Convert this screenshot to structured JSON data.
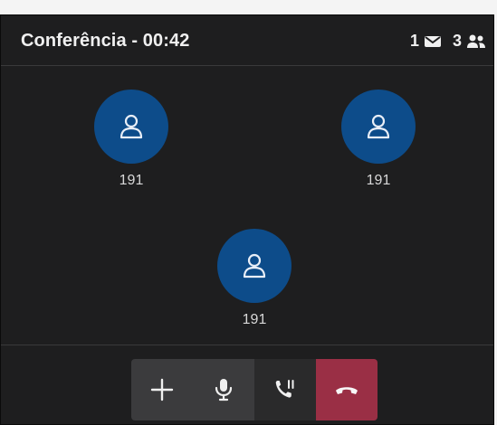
{
  "header": {
    "title": "Conferência - 00:42",
    "messages_count": "1",
    "participants_count": "3"
  },
  "participants": [
    {
      "name": "191"
    },
    {
      "name": "191"
    },
    {
      "name": "191"
    }
  ],
  "controls": {
    "add": "plus-icon",
    "mic": "microphone-icon",
    "hold": "phone-hold-icon",
    "hangup": "phone-hangup-icon"
  },
  "colors": {
    "background": "#1e1e1f",
    "avatar": "#0d4c8a",
    "hangup": "#9a2f45",
    "control": "#3b3b3d"
  }
}
